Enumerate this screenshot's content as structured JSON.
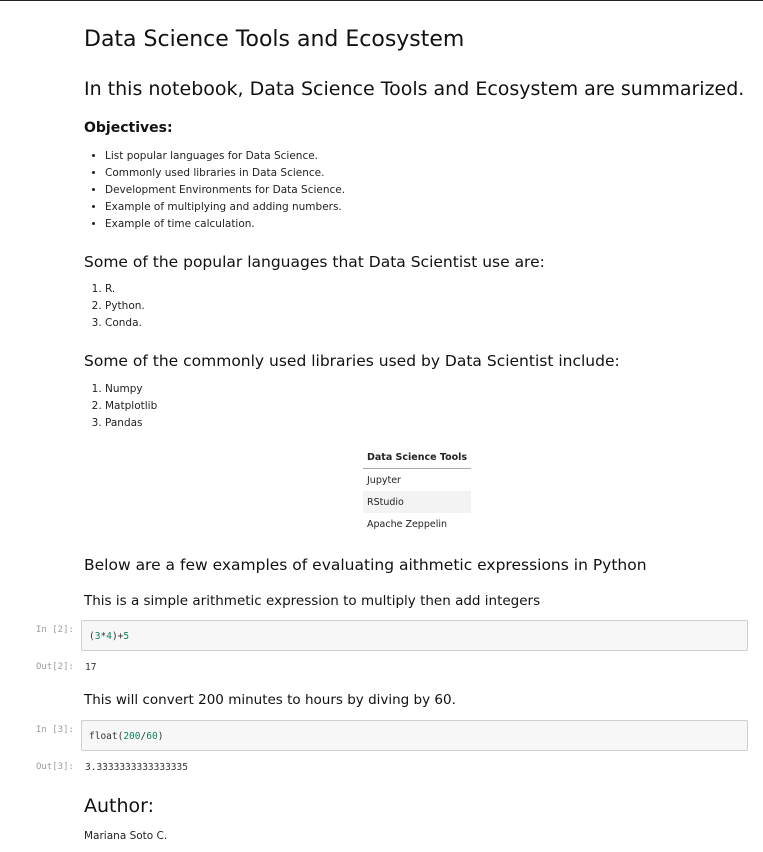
{
  "notebook": {
    "title": "Data Science Tools and Ecosystem",
    "intro": "In this notebook, Data Science Tools and Ecosystem are summarized.",
    "objectives_heading": "Objectives:",
    "objectives": [
      "List popular languages for Data Science.",
      "Commonly used libraries in Data Science.",
      "Development Environments for Data Science.",
      "Example of multiplying and adding numbers.",
      "Example of time calculation."
    ],
    "languages_heading": "Some of the popular languages that Data Scientist use are:",
    "languages": [
      "R.",
      "Python.",
      "Conda."
    ],
    "libraries_heading": "Some of the commonly used libraries used by Data Scientist include:",
    "libraries": [
      "Numpy",
      "Matplotlib",
      "Pandas"
    ],
    "tools_table": {
      "header": "Data Science Tools",
      "rows": [
        "Jupyter",
        "RStudio",
        "Apache Zeppelin"
      ]
    },
    "arith_heading": "Below are a few examples of evaluating aithmetic expressions in Python",
    "cell1": {
      "description": "This is a simple arithmetic expression to multiply then add integers",
      "in_prompt": "In [2]:",
      "code": {
        "p1": "(",
        "n1": "3",
        "op1": "*",
        "n2": "4",
        "p2": ")+",
        "n3": "5"
      },
      "out_prompt": "Out[2]:",
      "output": "17"
    },
    "cell2": {
      "description": "This will convert 200 minutes to hours by diving by 60.",
      "in_prompt": "In [3]:",
      "code": {
        "fn": "float(",
        "n1": "200",
        "op": "/",
        "n2": "60",
        "close": ")"
      },
      "out_prompt": "Out[3]:",
      "output": "3.3333333333333335"
    },
    "author_heading": "Author:",
    "author_name": "Mariana Soto C."
  },
  "colors": {
    "number_literal": "#098658",
    "prompt": "#9a9a9a",
    "code_bg": "#f7f7f7"
  }
}
